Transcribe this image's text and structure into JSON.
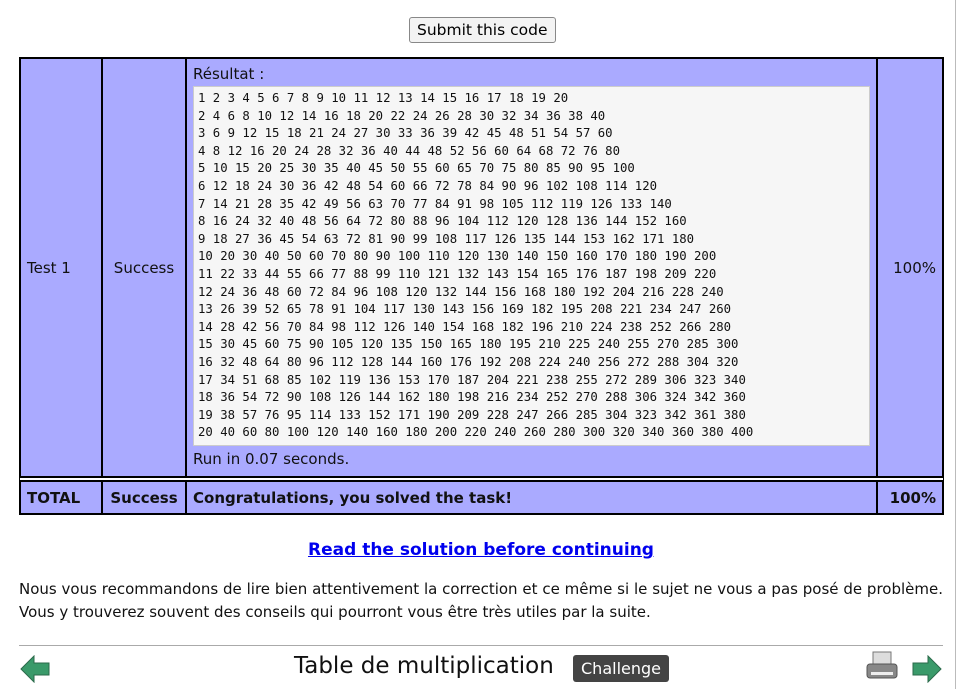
{
  "submit_label": "Submit this code",
  "tests": [
    {
      "name": "Test 1",
      "status": "Success",
      "result_label": "Résultat :",
      "output": [
        "1 2 3 4 5 6 7 8 9 10 11 12 13 14 15 16 17 18 19 20",
        "2 4 6 8 10 12 14 16 18 20 22 24 26 28 30 32 34 36 38 40",
        "3 6 9 12 15 18 21 24 27 30 33 36 39 42 45 48 51 54 57 60",
        "4 8 12 16 20 24 28 32 36 40 44 48 52 56 60 64 68 72 76 80",
        "5 10 15 20 25 30 35 40 45 50 55 60 65 70 75 80 85 90 95 100",
        "6 12 18 24 30 36 42 48 54 60 66 72 78 84 90 96 102 108 114 120",
        "7 14 21 28 35 42 49 56 63 70 77 84 91 98 105 112 119 126 133 140",
        "8 16 24 32 40 48 56 64 72 80 88 96 104 112 120 128 136 144 152 160",
        "9 18 27 36 45 54 63 72 81 90 99 108 117 126 135 144 153 162 171 180",
        "10 20 30 40 50 60 70 80 90 100 110 120 130 140 150 160 170 180 190 200",
        "11 22 33 44 55 66 77 88 99 110 121 132 143 154 165 176 187 198 209 220",
        "12 24 36 48 60 72 84 96 108 120 132 144 156 168 180 192 204 216 228 240",
        "13 26 39 52 65 78 91 104 117 130 143 156 169 182 195 208 221 234 247 260",
        "14 28 42 56 70 84 98 112 126 140 154 168 182 196 210 224 238 252 266 280",
        "15 30 45 60 75 90 105 120 135 150 165 180 195 210 225 240 255 270 285 300",
        "16 32 48 64 80 96 112 128 144 160 176 192 208 224 240 256 272 288 304 320",
        "17 34 51 68 85 102 119 136 153 170 187 204 221 238 255 272 289 306 323 340",
        "18 36 54 72 90 108 126 144 162 180 198 216 234 252 270 288 306 324 342 360",
        "19 38 57 76 95 114 133 152 171 190 209 228 247 266 285 304 323 342 361 380",
        "20 40 60 80 100 120 140 160 180 200 220 240 260 280 300 320 340 360 380 400"
      ],
      "runtime": "Run in 0.07 seconds.",
      "score": "100%"
    }
  ],
  "total": {
    "label": "TOTAL",
    "status": "Success",
    "message": "Congratulations, you solved the task!",
    "score": "100%"
  },
  "solution_link": "Read the solution before continuing",
  "advice": "Nous vous recommandons de lire bien attentivement la correction et ce même si le sujet ne vous a pas posé de problème. Vous y trouverez souvent des conseils qui pourront vous être très utiles par la suite.",
  "footer": {
    "title": "Table de multiplication",
    "badge": "Challenge",
    "icons": [
      "arrow-left-icon",
      "printer-icon",
      "arrow-right-icon"
    ]
  },
  "colors": {
    "table_bg": "#aaaaff",
    "arrow": "#3a9a6a",
    "link": "#0000ee"
  }
}
